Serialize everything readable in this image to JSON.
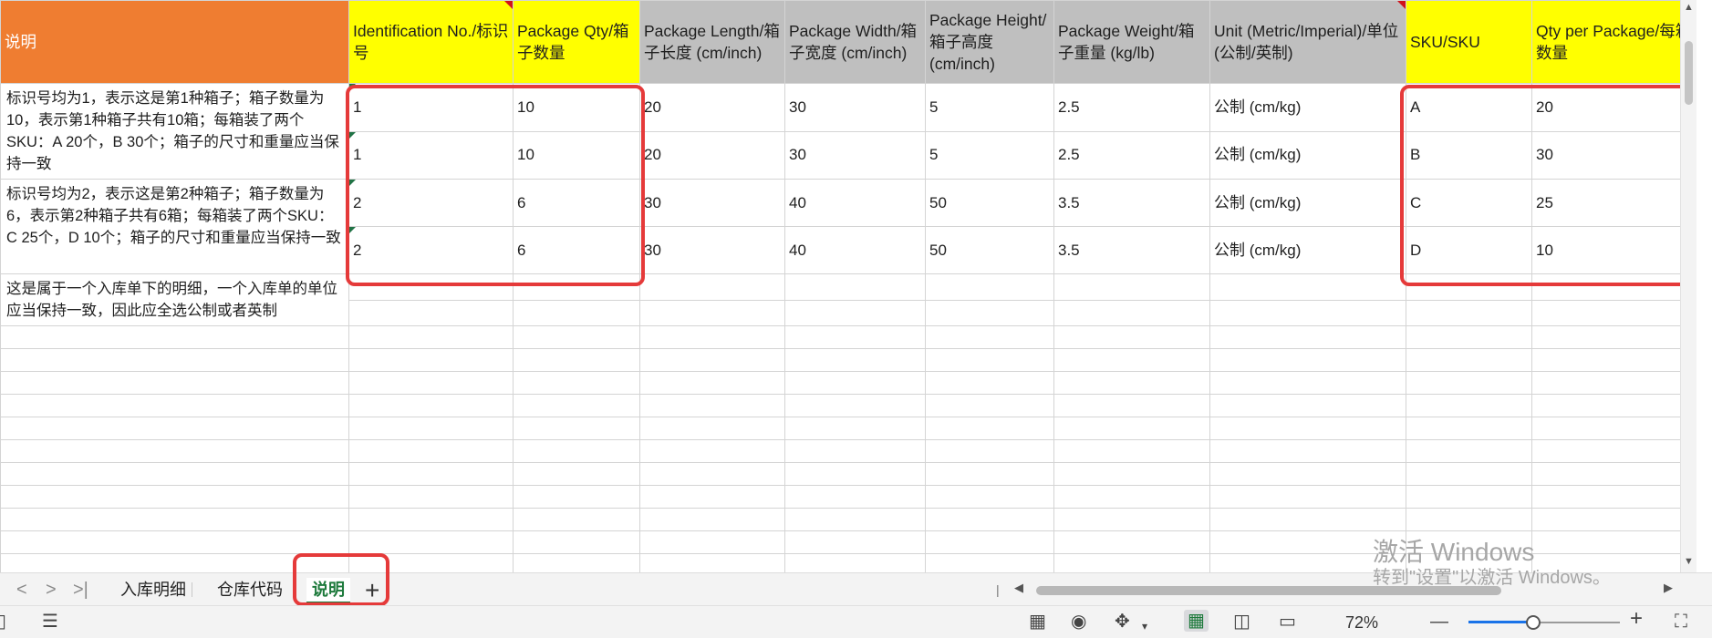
{
  "sheet": {
    "headers": [
      {
        "text": "说明",
        "style": "orange"
      },
      {
        "text": "Identification No./标识号",
        "style": "yellow",
        "red_corner": true
      },
      {
        "text": "Package Qty/箱子数量",
        "style": "yellow"
      },
      {
        "text": "Package Length/箱子长度 (cm/inch)",
        "style": "gray"
      },
      {
        "text": "Package Width/箱子宽度 (cm/inch)",
        "style": "gray"
      },
      {
        "text": "Package Height/箱子高度 (cm/inch)",
        "style": "gray"
      },
      {
        "text": "Package Weight/箱子重量 (kg/lb)",
        "style": "gray"
      },
      {
        "text": "Unit (Metric/Imperial)/单位 (公制/英制)",
        "style": "gray",
        "red_corner": true
      },
      {
        "text": "SKU/SKU",
        "style": "yellow"
      },
      {
        "text": "Qty per Package/每箱数量",
        "style": "yellow"
      }
    ],
    "notes": [
      "标识号均为1，表示这是第1种箱子；箱子数量为10，表示第1种箱子共有10箱；每箱装了两个SKU：A 20个，B 30个；箱子的尺寸和重量应当保持一致",
      "标识号均为2，表示这是第2种箱子；箱子数量为6，表示第2种箱子共有6箱；每箱装了两个SKU：C 25个，D 10个；箱子的尺寸和重量应当保持一致",
      "这是属于一个入库单下的明细，一个入库单的单位应当保持一致，因此应全选公制或者英制"
    ],
    "rows": [
      [
        "1",
        "10",
        "20",
        "30",
        "5",
        "2.5",
        "公制 (cm/kg)",
        "A",
        "20"
      ],
      [
        "1",
        "10",
        "20",
        "30",
        "5",
        "2.5",
        "公制 (cm/kg)",
        "B",
        "30"
      ],
      [
        "2",
        "6",
        "30",
        "40",
        "50",
        "3.5",
        "公制 (cm/kg)",
        "C",
        "25"
      ],
      [
        "2",
        "6",
        "30",
        "40",
        "50",
        "3.5",
        "公制 (cm/kg)",
        "D",
        "10"
      ]
    ]
  },
  "tabs": {
    "items": [
      "入库明细",
      "仓库代码",
      "说明"
    ],
    "active": "说明",
    "add_label": "+"
  },
  "nav": {
    "first": "<",
    "prev": ">",
    "last": ">|"
  },
  "statusbar": {
    "zoom": "72%",
    "zoom_out": "—",
    "zoom_in": "+",
    "zoom_level": 0.42
  },
  "watermark": {
    "line1": "激活 Windows",
    "line2": "转到\"设置\"以激活 Windows。"
  },
  "colors": {
    "header_orange": "#ef7d31",
    "header_yellow": "#ffff00",
    "header_gray": "#bfbfbf",
    "highlight_red": "#e53a3a",
    "active_tab_green": "#1e7a3c"
  },
  "icons": [
    "reading-layout-icon",
    "eye-icon",
    "crosshair-icon",
    "normal-view-icon",
    "page-break-view-icon",
    "page-layout-view-icon",
    "fullscreen-icon",
    "sidebar-toggle-icon",
    "list-icon"
  ]
}
